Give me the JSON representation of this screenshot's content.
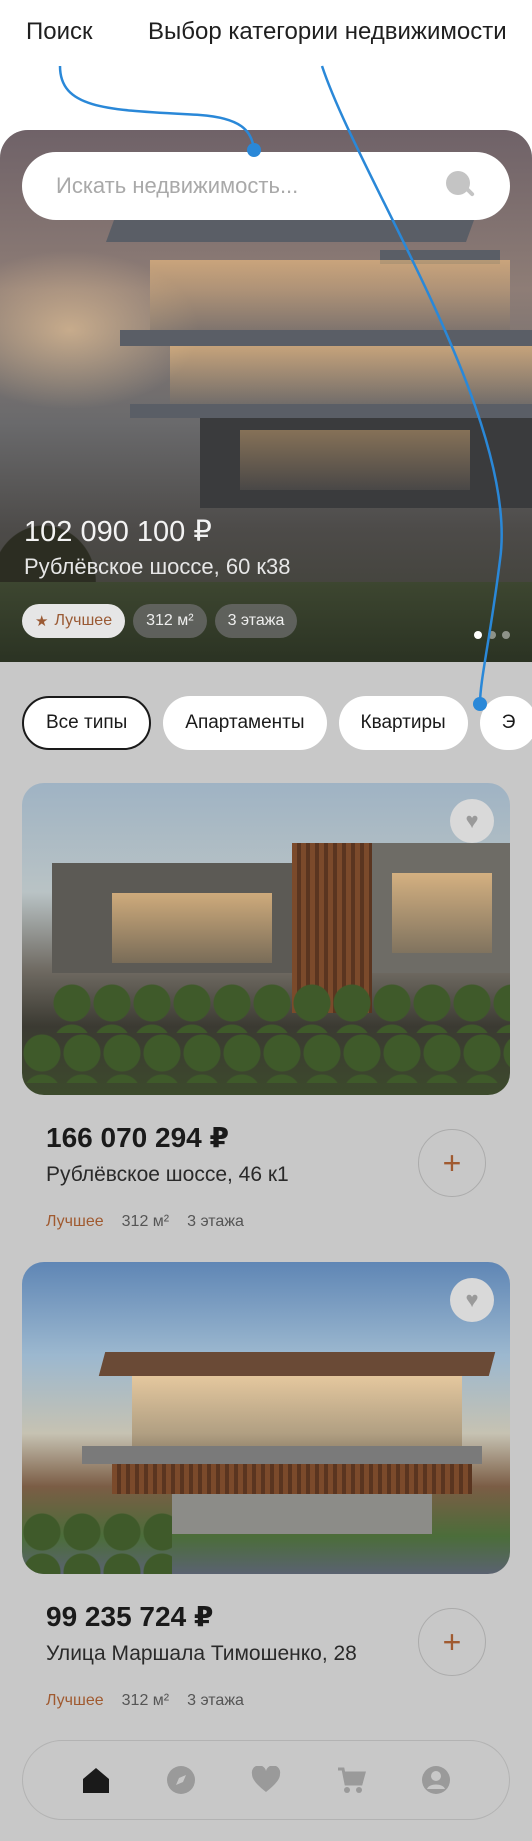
{
  "annotations": {
    "search": "Поиск",
    "category": "Выбор категории недвижимости"
  },
  "search": {
    "placeholder": "Искать недвижимость..."
  },
  "hero": {
    "price": "102 090 100 ₽",
    "address": "Рублёвское шоссе, 60 к38",
    "tags": {
      "best": "Лучшее",
      "area": "312 м²",
      "floors": "3 этажа"
    },
    "slides": 3,
    "active_slide": 1
  },
  "categories": [
    "Все типы",
    "Апартаменты",
    "Квартиры",
    "Э"
  ],
  "listings": [
    {
      "price": "166 070 294 ₽",
      "address": "Рублёвское шоссе, 46 к1",
      "best": "Лучшее",
      "area": "312 м²",
      "floors": "3 этажа"
    },
    {
      "price": "99 235 724 ₽",
      "address": "Улица Маршала Тимошенко, 28",
      "best": "Лучшее",
      "area": "312 м²",
      "floors": "3 этажа"
    }
  ],
  "tabbar": [
    "home-icon",
    "compass-icon",
    "heart-icon",
    "cart-icon",
    "profile-icon"
  ],
  "colors": {
    "accent": "#a05a30",
    "annotation_line": "#2a88d8",
    "screen_bg": "#c8c8c8"
  }
}
